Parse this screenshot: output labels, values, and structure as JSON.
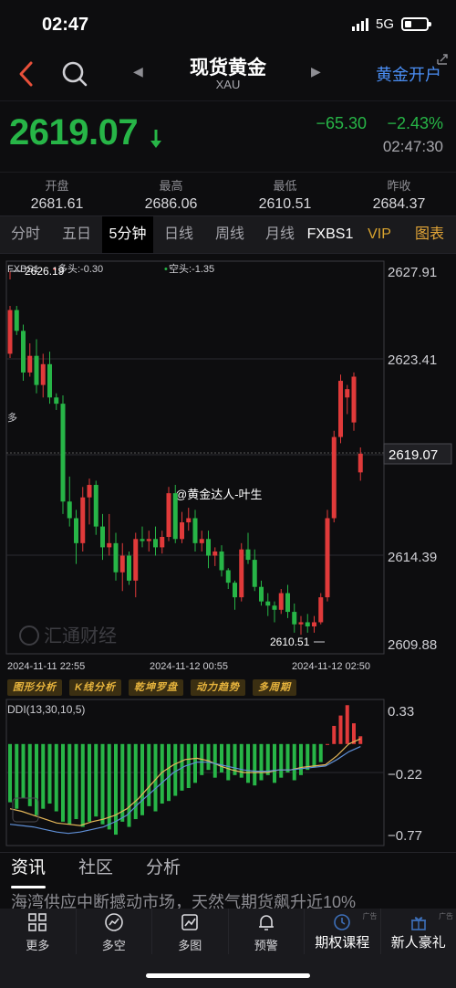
{
  "status": {
    "time": "02:47",
    "network": "5G"
  },
  "nav": {
    "title": "现货黄金",
    "subtitle": "XAU",
    "open_account": "黄金开户"
  },
  "quote": {
    "price": "2619.07",
    "change": "−65.30",
    "change_pct": "−2.43%",
    "time": "02:47:30"
  },
  "stats": [
    {
      "label": "开盘",
      "value": "2681.61"
    },
    {
      "label": "最高",
      "value": "2686.06"
    },
    {
      "label": "最低",
      "value": "2610.51"
    },
    {
      "label": "昨收",
      "value": "2684.37"
    }
  ],
  "tabs": [
    "分时",
    "五日",
    "5分钟",
    "日线",
    "周线",
    "月线",
    "FXBS1",
    "VIP",
    "图表"
  ],
  "active_tab": "5分钟",
  "colors": {
    "up": "#e03a3a",
    "down": "#27b547",
    "accent": "#4a8ef4",
    "gold": "#e2a537"
  },
  "chart": {
    "indicator_name": "FXBS1",
    "long_label": "多头:-0.30",
    "short_label": "空头:-1.35",
    "side_marker": "多",
    "price_ticks": [
      "2627.91",
      "2623.41",
      "2619.07",
      "2614.39",
      "2609.88"
    ],
    "high_marker": "2626.19",
    "low_marker": "2610.51",
    "dates": [
      "2024-11-11 22:55",
      "2024-11-12 00:55",
      "2024-11-12 02:50"
    ],
    "watermark_user": "@黄金达人-叶生",
    "watermark_brand": "汇通财经",
    "tools": [
      "图形分析",
      "K线分析",
      "乾坤罗盘",
      "动力趋势",
      "多周期"
    ],
    "ddi_label": "DDI(13,30,10,5)",
    "ddi_ticks": [
      "0.33",
      "−0.22",
      "−0.77"
    ]
  },
  "chart_data": {
    "type": "candlestick",
    "title": "",
    "xlabel": "",
    "ylabel": "",
    "ylim": [
      2609.88,
      2627.91
    ],
    "x_range": [
      "2024-11-11 22:55",
      "2024-11-12 02:50"
    ],
    "candles": [
      [
        2623.9,
        2626.2,
        2623.7,
        2626.0
      ],
      [
        2626.0,
        2626.2,
        2624.8,
        2625.0
      ],
      [
        2625.0,
        2625.3,
        2622.6,
        2623.0
      ],
      [
        2623.0,
        2624.4,
        2622.8,
        2623.8
      ],
      [
        2623.8,
        2624.6,
        2622.0,
        2622.4
      ],
      [
        2622.4,
        2623.9,
        2621.8,
        2623.4
      ],
      [
        2623.4,
        2624.0,
        2621.5,
        2621.8
      ],
      [
        2621.8,
        2622.0,
        2621.2,
        2621.5
      ],
      [
        2621.5,
        2621.9,
        2616.2,
        2616.8
      ],
      [
        2616.8,
        2618.0,
        2615.6,
        2616.0
      ],
      [
        2616.0,
        2616.4,
        2613.8,
        2614.8
      ],
      [
        2614.8,
        2617.5,
        2614.4,
        2617.0
      ],
      [
        2617.0,
        2617.9,
        2615.7,
        2617.6
      ],
      [
        2617.6,
        2617.8,
        2615.2,
        2615.6
      ],
      [
        2615.6,
        2616.2,
        2614.0,
        2614.6
      ],
      [
        2614.6,
        2616.2,
        2614.2,
        2614.8
      ],
      [
        2614.8,
        2615.3,
        2613.0,
        2613.4
      ],
      [
        2613.4,
        2614.8,
        2612.5,
        2614.2
      ],
      [
        2614.2,
        2614.4,
        2612.8,
        2613.0
      ],
      [
        2613.0,
        2615.3,
        2612.2,
        2615.0
      ],
      [
        2615.0,
        2615.6,
        2614.6,
        2614.9
      ],
      [
        2614.9,
        2615.4,
        2614.4,
        2615.0
      ],
      [
        2615.0,
        2615.6,
        2614.2,
        2614.6
      ],
      [
        2614.6,
        2615.4,
        2614.3,
        2615.1
      ],
      [
        2615.1,
        2617.5,
        2614.9,
        2617.2
      ],
      [
        2617.2,
        2617.6,
        2614.8,
        2615.0
      ],
      [
        2615.0,
        2616.3,
        2614.8,
        2615.8
      ],
      [
        2615.8,
        2616.5,
        2615.4,
        2616.0
      ],
      [
        2616.0,
        2616.4,
        2614.4,
        2614.8
      ],
      [
        2614.8,
        2615.4,
        2614.4,
        2615.0
      ],
      [
        2615.0,
        2615.4,
        2613.6,
        2614.2
      ],
      [
        2614.2,
        2614.6,
        2613.7,
        2614.4
      ],
      [
        2614.4,
        2614.7,
        2613.2,
        2613.5
      ],
      [
        2613.5,
        2613.6,
        2612.6,
        2612.9
      ],
      [
        2612.9,
        2613.0,
        2611.6,
        2612.2
      ],
      [
        2612.2,
        2614.8,
        2612.0,
        2614.5
      ],
      [
        2614.5,
        2615.3,
        2613.8,
        2614.0
      ],
      [
        2614.0,
        2614.5,
        2612.5,
        2612.7
      ],
      [
        2612.7,
        2613.0,
        2611.8,
        2612.0
      ],
      [
        2612.0,
        2612.4,
        2611.3,
        2611.8
      ],
      [
        2611.8,
        2612.0,
        2611.0,
        2611.6
      ],
      [
        2611.6,
        2612.6,
        2611.4,
        2612.4
      ],
      [
        2612.4,
        2612.8,
        2611.2,
        2611.5
      ],
      [
        2611.5,
        2611.9,
        2610.5,
        2610.9
      ],
      [
        2610.9,
        2611.3,
        2610.4,
        2611.0
      ],
      [
        2611.0,
        2611.4,
        2610.5,
        2610.8
      ],
      [
        2610.8,
        2611.3,
        2610.5,
        2611.0
      ],
      [
        2611.0,
        2612.4,
        2610.9,
        2612.2
      ],
      [
        2612.2,
        2616.4,
        2612.0,
        2616.0
      ],
      [
        2616.0,
        2620.2,
        2615.8,
        2619.9
      ],
      [
        2619.9,
        2622.9,
        2619.6,
        2622.6
      ],
      [
        2621.8,
        2622.4,
        2621.0,
        2622.2
      ],
      [
        2620.6,
        2623.0,
        2620.2,
        2622.8
      ],
      [
        2618.2,
        2619.4,
        2617.8,
        2619.1
      ]
    ],
    "ddi": {
      "ylim": [
        -0.77,
        0.33
      ],
      "histogram": [
        -0.45,
        -0.5,
        -0.42,
        -0.48,
        -0.55,
        -0.5,
        -0.46,
        -0.52,
        -0.6,
        -0.62,
        -0.58,
        -0.64,
        -0.6,
        -0.56,
        -0.62,
        -0.66,
        -0.7,
        -0.6,
        -0.64,
        -0.58,
        -0.55,
        -0.48,
        -0.52,
        -0.46,
        -0.44,
        -0.4,
        -0.36,
        -0.34,
        -0.3,
        -0.24,
        -0.2,
        -0.26,
        -0.22,
        -0.28,
        -0.24,
        -0.26,
        -0.3,
        -0.32,
        -0.28,
        -0.24,
        -0.3,
        -0.26,
        -0.22,
        -0.28,
        -0.24,
        -0.2,
        -0.18,
        -0.14,
        0.0,
        0.14,
        0.22,
        0.3,
        0.16,
        0.06
      ],
      "line_a": [
        -0.5,
        -0.52,
        -0.55,
        -0.58,
        -0.61,
        -0.62,
        -0.63,
        -0.6,
        -0.58,
        -0.55,
        -0.5,
        -0.42,
        -0.32,
        -0.22,
        -0.16,
        -0.12,
        -0.11,
        -0.13,
        -0.17,
        -0.2,
        -0.22,
        -0.22,
        -0.22,
        -0.2,
        -0.2,
        -0.18,
        -0.17,
        -0.16,
        -0.09,
        0.0,
        0.04
      ],
      "line_b": [
        -0.62,
        -0.63,
        -0.64,
        -0.66,
        -0.68,
        -0.69,
        -0.68,
        -0.66,
        -0.64,
        -0.6,
        -0.55,
        -0.46,
        -0.38,
        -0.3,
        -0.22,
        -0.17,
        -0.14,
        -0.14,
        -0.16,
        -0.18,
        -0.2,
        -0.21,
        -0.21,
        -0.2,
        -0.2,
        -0.19,
        -0.18,
        -0.17,
        -0.12,
        -0.06,
        -0.02
      ]
    }
  },
  "news_tabs": [
    "资讯",
    "社区",
    "分析"
  ],
  "headline": "海湾供应中断撼动市场，天然气期货飙升近10%",
  "bottom_bar": [
    {
      "label": "更多",
      "icon": "grid-icon"
    },
    {
      "label": "多空",
      "icon": "gauge-icon"
    },
    {
      "label": "多图",
      "icon": "multi-chart-icon"
    },
    {
      "label": "预警",
      "icon": "bell-icon"
    },
    {
      "label": "期权课程",
      "icon": "clock-icon",
      "ad": "广告"
    },
    {
      "label": "新人豪礼",
      "icon": "gift-icon",
      "ad": "广告"
    }
  ]
}
